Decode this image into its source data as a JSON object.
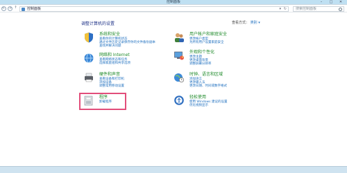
{
  "window": {
    "title": "控制面板",
    "controls": [
      "–",
      "□",
      "✕"
    ]
  },
  "addressbar": {
    "breadcrumb": "控制面板",
    "search_placeholder": "搜索控制面板",
    "back": "←",
    "forward": "→",
    "up": "↑",
    "dropdown": "▾",
    "refresh": "↻"
  },
  "page": {
    "heading": "调整计算机的设置",
    "view_by_label": "查看方式：",
    "view_by_value": "类别 ▾"
  },
  "categories": [
    {
      "title": "系统和安全",
      "links": [
        "查看你的计算机状态",
        "通过文件历史记录保存你的文件备份副本",
        "查找并解决问题"
      ],
      "icon": "shield-icon"
    },
    {
      "title": "网络和 Internet",
      "links": [
        "查看网络状态和任务",
        "选择家庭组和共享选项"
      ],
      "icon": "globe-network-icon"
    },
    {
      "title": "硬件和声音",
      "links": [
        "查看设备和打印机",
        "添加设备",
        "调整常用移动设置"
      ],
      "icon": "printer-icon"
    },
    {
      "title": "程序",
      "links": [
        "卸载程序"
      ],
      "icon": "programs-icon"
    },
    {
      "title": "用户帐户和家庭安全",
      "links": [
        "更改帐户类型",
        "为所有用户设置家庭安全"
      ],
      "icon": "users-icon"
    },
    {
      "title": "外观和个性化",
      "links": [
        "更改主题",
        "更改桌面背景",
        "调整屏幕分辨率"
      ],
      "icon": "appearance-icon"
    },
    {
      "title": "时钟、语言和区域",
      "links": [
        "添加语言",
        "更改输入法",
        "更改日期、时间或数字格式"
      ],
      "icon": "clock-globe-icon"
    },
    {
      "title": "轻松使用",
      "links": [
        "使用 Windows 建议的设置",
        "优化视频显示"
      ],
      "icon": "ease-of-access-icon"
    }
  ]
}
